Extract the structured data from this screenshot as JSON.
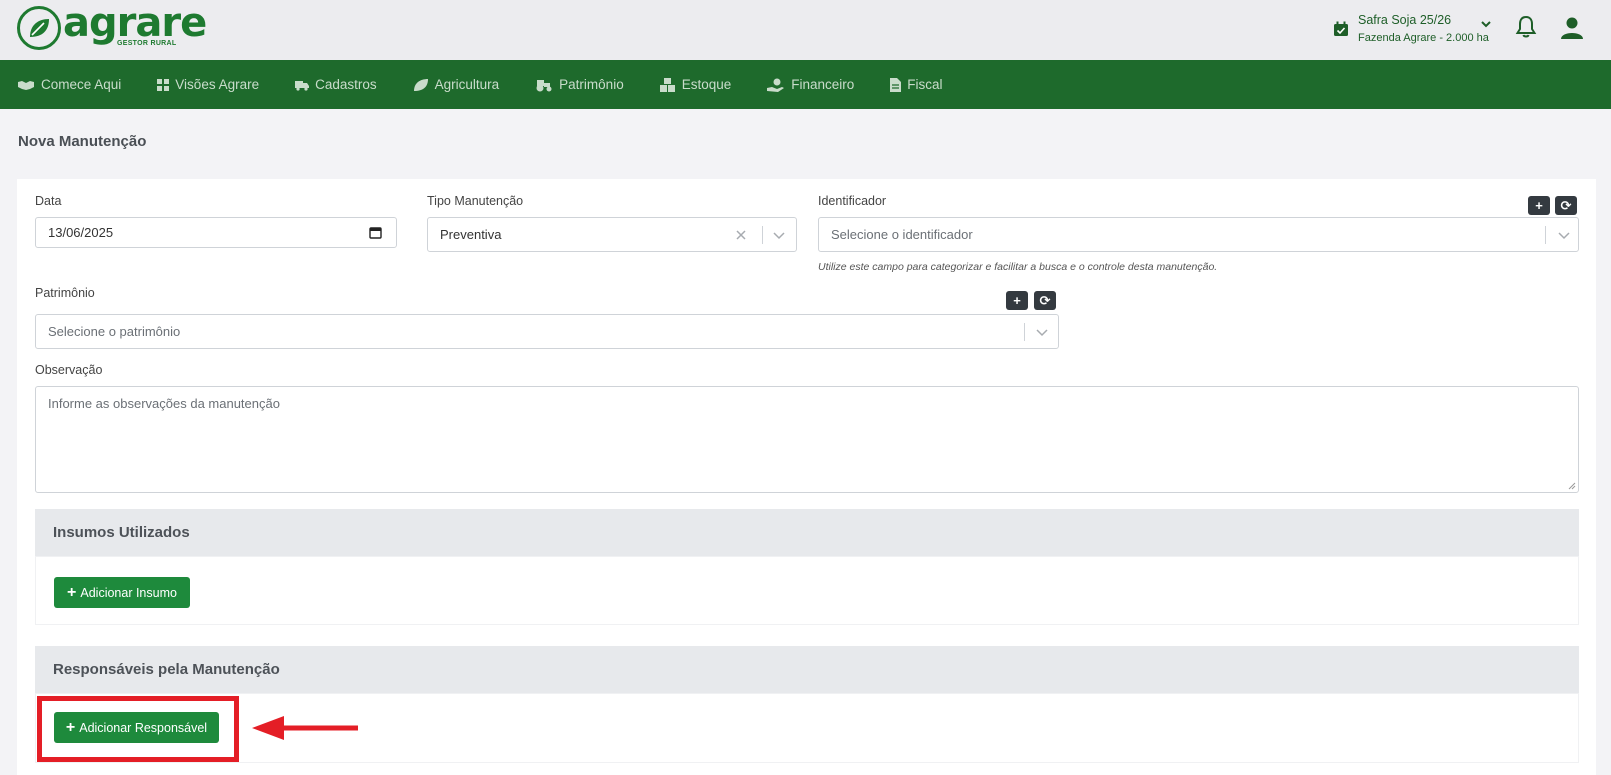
{
  "brand": {
    "name": "agrare",
    "tagline": "GESTOR RURAL"
  },
  "header": {
    "season_title": "Safra Soja 25/26",
    "farm_subtitle": "Fazenda Agrare - 2.000 ha"
  },
  "nav": {
    "items": [
      {
        "label": "Comece Aqui",
        "icon": "handshake-icon"
      },
      {
        "label": "Visões Agrare",
        "icon": "dashboard-icon"
      },
      {
        "label": "Cadastros",
        "icon": "truck-icon"
      },
      {
        "label": "Agricultura",
        "icon": "leaf-icon"
      },
      {
        "label": "Patrimônio",
        "icon": "tractor-icon"
      },
      {
        "label": "Estoque",
        "icon": "boxes-icon"
      },
      {
        "label": "Financeiro",
        "icon": "hand-money-icon"
      },
      {
        "label": "Fiscal",
        "icon": "document-icon"
      }
    ]
  },
  "page": {
    "title": "Nova Manutenção"
  },
  "form": {
    "date": {
      "label": "Data",
      "value": "13/06/2025"
    },
    "tipo": {
      "label": "Tipo Manutenção",
      "value": "Preventiva"
    },
    "identificador": {
      "label": "Identificador",
      "placeholder": "Selecione o identificador",
      "help": "Utilize este campo para categorizar e facilitar a busca e o controle desta manutenção.",
      "add_label": "+",
      "refresh_label": "⟳"
    },
    "patrimonio": {
      "label": "Patrimônio",
      "placeholder": "Selecione o patrimônio",
      "add_label": "+",
      "refresh_label": "⟳"
    },
    "observacao": {
      "label": "Observação",
      "placeholder": "Informe as observações da manutenção"
    }
  },
  "insumos": {
    "title": "Insumos Utilizados",
    "button_label": "Adicionar Insumo"
  },
  "responsaveis": {
    "title": "Responsáveis pela Manutenção",
    "button_label": "Adicionar Responsável"
  },
  "colors": {
    "brand_green": "#1e7a30",
    "nav_green": "#1e6a2c",
    "button_green": "#1e8a3c",
    "annotation_red": "#e41e26"
  }
}
